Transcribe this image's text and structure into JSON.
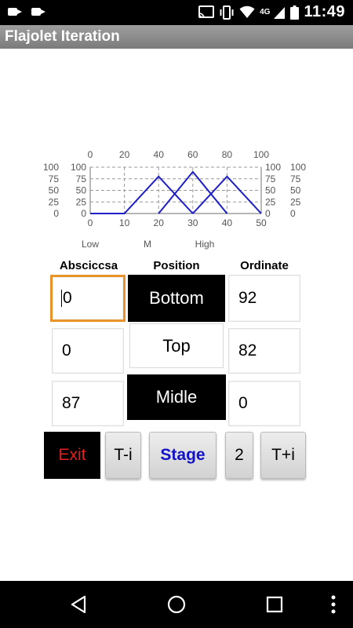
{
  "status_bar": {
    "time": "11:49",
    "network": "4G"
  },
  "app": {
    "title": "Flajolet Iteration"
  },
  "chart_data": {
    "type": "line",
    "x_bottom": {
      "range": [
        0,
        50
      ],
      "ticks": [
        "0",
        "10",
        "20",
        "30",
        "40",
        "50"
      ]
    },
    "x_top": {
      "range": [
        0,
        100
      ],
      "ticks": [
        "0",
        "20",
        "40",
        "60",
        "80",
        "100"
      ]
    },
    "y": {
      "range": [
        0,
        100
      ],
      "ticks": [
        "0",
        "25",
        "50",
        "75",
        "100"
      ]
    },
    "category_labels": [
      "Low",
      "M",
      "High"
    ],
    "grid": true,
    "line_color": "#1e1ec8",
    "series": [
      {
        "x": [
          0,
          10,
          20,
          30
        ],
        "y": [
          0,
          0,
          80,
          0
        ]
      },
      {
        "x": [
          20,
          30,
          40
        ],
        "y": [
          0,
          90,
          0
        ]
      },
      {
        "x": [
          30,
          40,
          50
        ],
        "y": [
          0,
          80,
          0
        ]
      }
    ]
  },
  "headers": {
    "abscissa": "Absciccsa",
    "position": "Position",
    "ordinate": "Ordinate"
  },
  "rows": [
    {
      "abscissa": "0",
      "position": "Bottom",
      "ordinate": "92"
    },
    {
      "abscissa": "0",
      "position": "Top",
      "ordinate": "82"
    },
    {
      "abscissa": "87",
      "position": "Midle",
      "ordinate": "0"
    }
  ],
  "buttons": {
    "exit": "Exit",
    "t_minus": "T-i",
    "stage": "Stage",
    "number": "2",
    "t_plus": "T+i"
  }
}
